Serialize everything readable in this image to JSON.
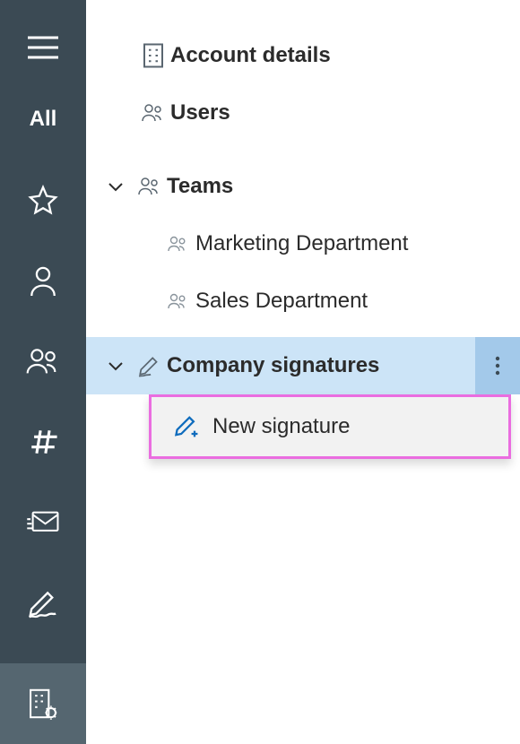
{
  "sidebar": {
    "all_label": "All"
  },
  "tree": {
    "account_details": "Account details",
    "users": "Users",
    "teams": "Teams",
    "marketing": "Marketing Department",
    "sales": "Sales Department",
    "company_signatures": "Company signatures"
  },
  "action": {
    "new_signature": "New signature"
  }
}
